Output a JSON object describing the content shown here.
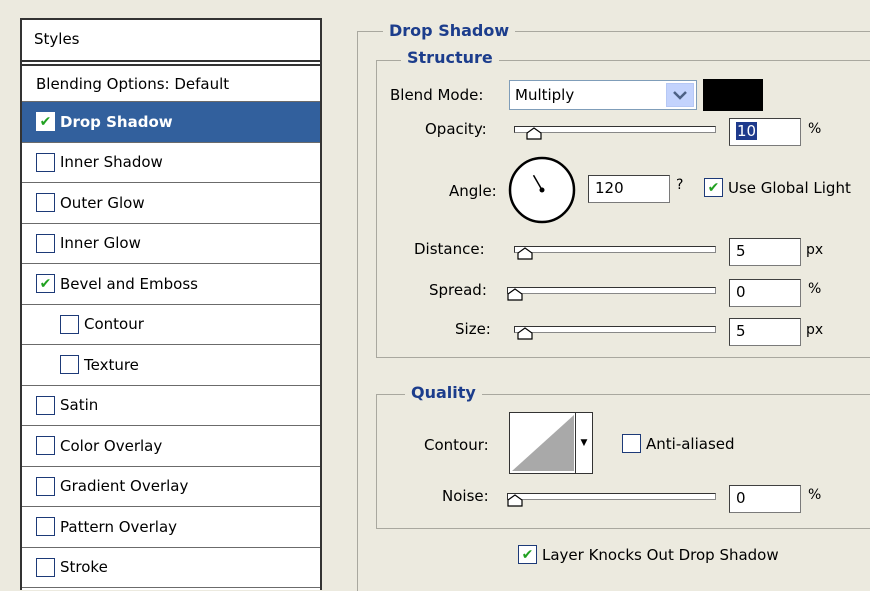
{
  "styles_list": {
    "header": "Styles",
    "blending_options": "Blending Options: Default",
    "items": [
      {
        "label": "Drop Shadow",
        "checked": true,
        "selected": true,
        "indent": false
      },
      {
        "label": "Inner Shadow",
        "checked": false,
        "selected": false,
        "indent": false
      },
      {
        "label": "Outer Glow",
        "checked": false,
        "selected": false,
        "indent": false
      },
      {
        "label": "Inner Glow",
        "checked": false,
        "selected": false,
        "indent": false
      },
      {
        "label": "Bevel and Emboss",
        "checked": true,
        "selected": false,
        "indent": false
      },
      {
        "label": "Contour",
        "checked": false,
        "selected": false,
        "indent": true
      },
      {
        "label": "Texture",
        "checked": false,
        "selected": false,
        "indent": true
      },
      {
        "label": "Satin",
        "checked": false,
        "selected": false,
        "indent": false
      },
      {
        "label": "Color Overlay",
        "checked": false,
        "selected": false,
        "indent": false
      },
      {
        "label": "Gradient Overlay",
        "checked": false,
        "selected": false,
        "indent": false
      },
      {
        "label": "Pattern Overlay",
        "checked": false,
        "selected": false,
        "indent": false
      },
      {
        "label": "Stroke",
        "checked": false,
        "selected": false,
        "indent": false
      }
    ]
  },
  "drop_shadow": {
    "title": "Drop Shadow",
    "structure": {
      "title": "Structure",
      "blend_mode_label": "Blend Mode:",
      "blend_mode_value": "Multiply",
      "shadow_color": "#000000",
      "opacity_label": "Opacity:",
      "opacity_value": "10",
      "opacity_unit": "%",
      "angle_label": "Angle:",
      "angle_value": "120",
      "angle_mark": "?",
      "use_global_light_label": "Use Global Light",
      "use_global_light_checked": true,
      "distance_label": "Distance:",
      "distance_value": "5",
      "distance_unit": "px",
      "spread_label": "Spread:",
      "spread_value": "0",
      "spread_unit": "%",
      "size_label": "Size:",
      "size_value": "5",
      "size_unit": "px"
    },
    "quality": {
      "title": "Quality",
      "contour_label": "Contour:",
      "anti_aliased_label": "Anti-aliased",
      "anti_aliased_checked": false,
      "noise_label": "Noise:",
      "noise_value": "0",
      "noise_unit": "%"
    },
    "knockout_label": "Layer Knocks Out Drop Shadow",
    "knockout_checked": true
  },
  "colors": {
    "selection": "#32609d",
    "legend_text": "#1c3d8c",
    "check_mark": "#21a121",
    "panel_bg": "#eceadf"
  }
}
